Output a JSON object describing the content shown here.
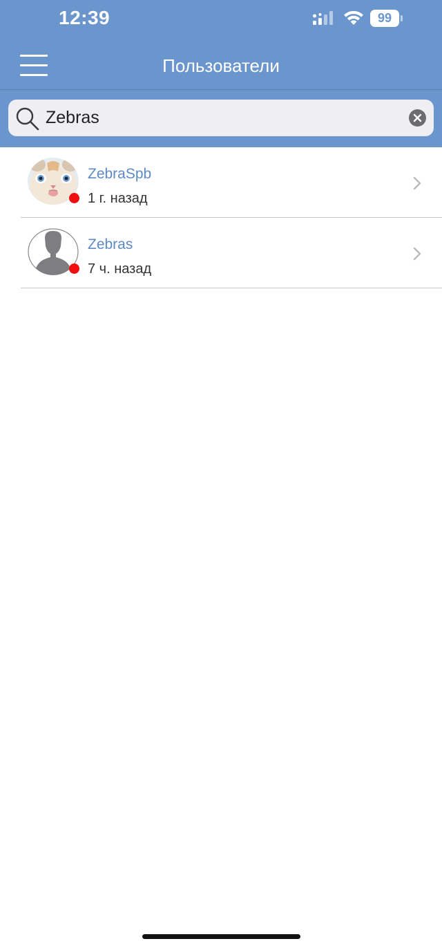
{
  "status_bar": {
    "time": "12:39",
    "battery": "99",
    "icons": [
      "signal-icon",
      "wifi-icon",
      "battery-icon"
    ]
  },
  "header": {
    "title": "Пользователи",
    "menu_icon": "hamburger-menu-icon"
  },
  "search": {
    "value": "Zebras",
    "icon": "search-icon",
    "clear_icon": "clear-icon"
  },
  "users": [
    {
      "name": "ZebraSpb",
      "last_seen": "1 г. назад",
      "avatar": "cat-photo",
      "status": "offline"
    },
    {
      "name": "Zebras",
      "last_seen": "7 ч. назад",
      "avatar": "default-silhouette",
      "status": "offline"
    }
  ],
  "colors": {
    "header_bg": "#6b95cd",
    "link": "#5c8ac4",
    "status_dot": "#f20f0f"
  }
}
